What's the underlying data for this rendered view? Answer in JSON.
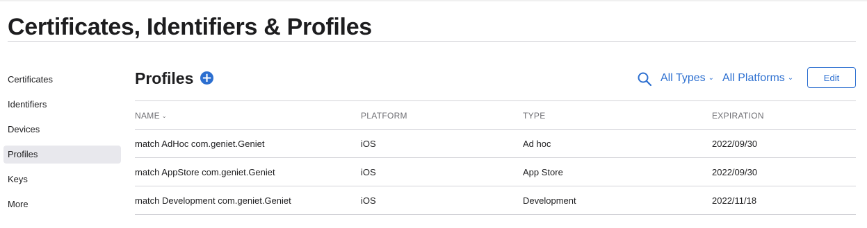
{
  "header": {
    "title": "Certificates, Identifiers & Profiles"
  },
  "sidebar": {
    "items": [
      {
        "label": "Certificates"
      },
      {
        "label": "Identifiers"
      },
      {
        "label": "Devices"
      },
      {
        "label": "Profiles",
        "active": true
      },
      {
        "label": "Keys"
      },
      {
        "label": "More"
      }
    ]
  },
  "main": {
    "title": "Profiles",
    "add_label": "+",
    "filters": {
      "types": "All Types",
      "platforms": "All Platforms"
    },
    "edit_label": "Edit",
    "table": {
      "columns": [
        "NAME",
        "PLATFORM",
        "TYPE",
        "EXPIRATION"
      ],
      "rows": [
        {
          "name": "match AdHoc com.geniet.Geniet",
          "platform": "iOS",
          "type": "Ad hoc",
          "expiration": "2022/09/30"
        },
        {
          "name": "match AppStore com.geniet.Geniet",
          "platform": "iOS",
          "type": "App Store",
          "expiration": "2022/09/30"
        },
        {
          "name": "match Development com.geniet.Geniet",
          "platform": "iOS",
          "type": "Development",
          "expiration": "2022/11/18"
        }
      ]
    }
  },
  "colors": {
    "accent": "#2c6fd0",
    "text": "#1d1d1f",
    "muted": "#6e6e73",
    "rule": "#d2d2d7",
    "active_bg": "#e8e8ed"
  },
  "icons": {
    "search": "search-icon",
    "add": "plus-circle-icon",
    "sort": "chevron-down-icon"
  }
}
